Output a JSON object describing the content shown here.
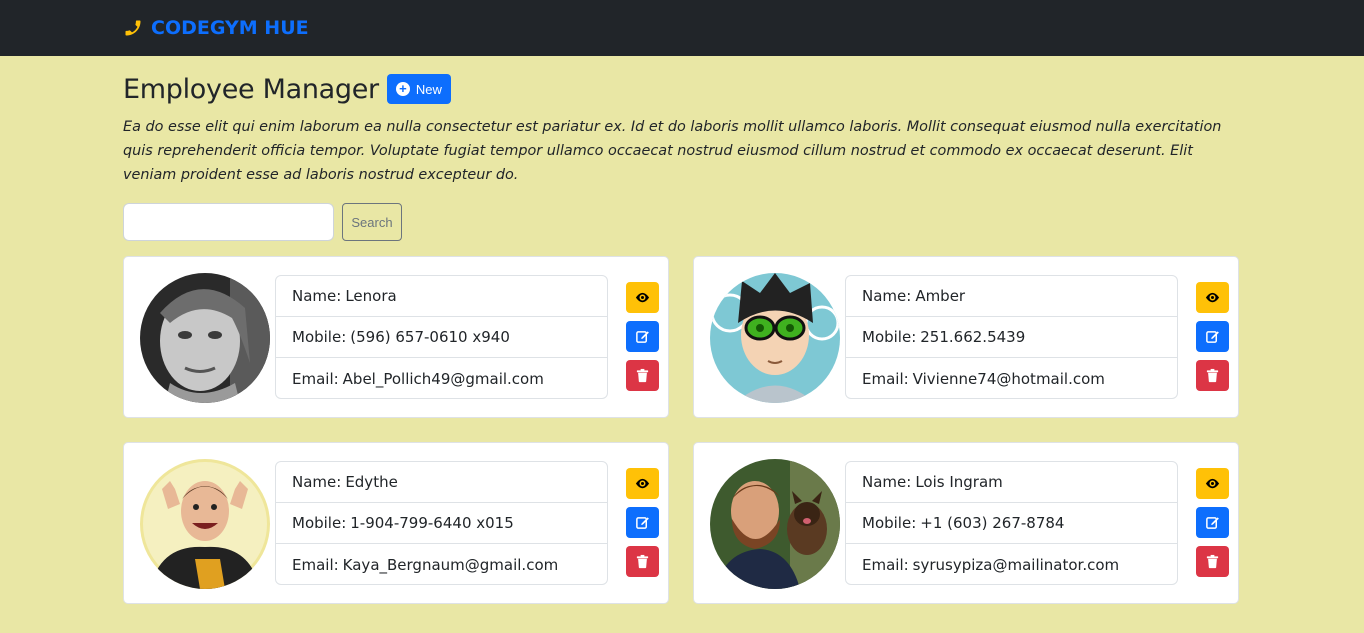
{
  "navbar": {
    "brand": "CODEGYM HUE"
  },
  "header": {
    "title": "Employee Manager",
    "new_label": "New",
    "description": "Ea do esse elit qui enim laborum ea nulla consectetur est pariatur ex. Id et do laboris mollit ullamco laboris. Mollit consequat eiusmod nulla exercitation quis reprehenderit officia tempor. Voluptate fugiat tempor ullamco occaecat nostrud eiusmod cillum nostrud et commodo ex occaecat deserunt. Elit veniam proident esse ad laboris nostrud excepteur do."
  },
  "search": {
    "value": "",
    "placeholder": "",
    "button_label": "Search"
  },
  "labels": {
    "name": "Name:",
    "mobile": "Mobile:",
    "email": "Email:"
  },
  "employees": [
    {
      "name": "Lenora",
      "mobile": "(596) 657-0610 x940",
      "email": "Abel_Pollich49@gmail.com"
    },
    {
      "name": "Amber",
      "mobile": "251.662.5439",
      "email": "Vivienne74@hotmail.com"
    },
    {
      "name": "Edythe",
      "mobile": "1-904-799-6440 x015",
      "email": "Kaya_Bergnaum@gmail.com"
    },
    {
      "name": "Lois Ingram",
      "mobile": "+1 (603) 267-8784",
      "email": "syrusypiza@mailinator.com"
    }
  ],
  "icons": {
    "brand": "phone-icon",
    "new": "plus-circle-icon",
    "view": "eye-icon",
    "edit": "edit-icon",
    "delete": "trash-icon"
  },
  "colors": {
    "background": "#e9e7a5",
    "navbar": "#212529",
    "brand_text": "#0d6efd",
    "brand_icon": "#ffc107",
    "primary": "#0d6efd",
    "warning": "#ffc107",
    "danger": "#dc3545"
  }
}
